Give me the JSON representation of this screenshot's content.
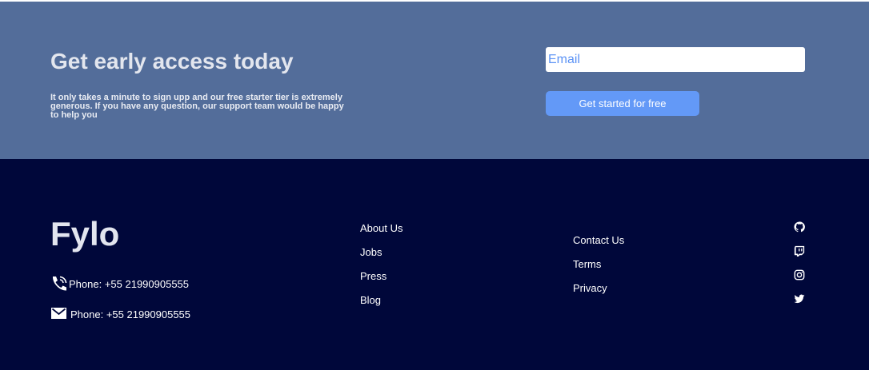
{
  "cta": {
    "title": "Get early access today",
    "description": "It only takes a minute to sign upp and our free starter tier is extremely generous. If you have any question, our support team would be happy to help you",
    "email_placeholder": "Email",
    "button_label": "Get started for free"
  },
  "footer": {
    "logo": "Fylo",
    "contacts": [
      {
        "icon": "phone-icon",
        "text": "Phone: +55 21990905555"
      },
      {
        "icon": "email-icon",
        "text": "Phone: +55 21990905555"
      }
    ],
    "links_col1": [
      "About Us",
      "Jobs",
      "Press",
      "Blog"
    ],
    "links_col2": [
      "Contact Us",
      "Terms",
      "Privacy"
    ],
    "social": [
      "github-icon",
      "twitch-icon",
      "instagram-icon",
      "twitter-icon"
    ]
  },
  "colors": {
    "cta_background": "#536d9a",
    "footer_background": "#00073a",
    "button": "#6399f7",
    "placeholder": "#5c93f5"
  }
}
